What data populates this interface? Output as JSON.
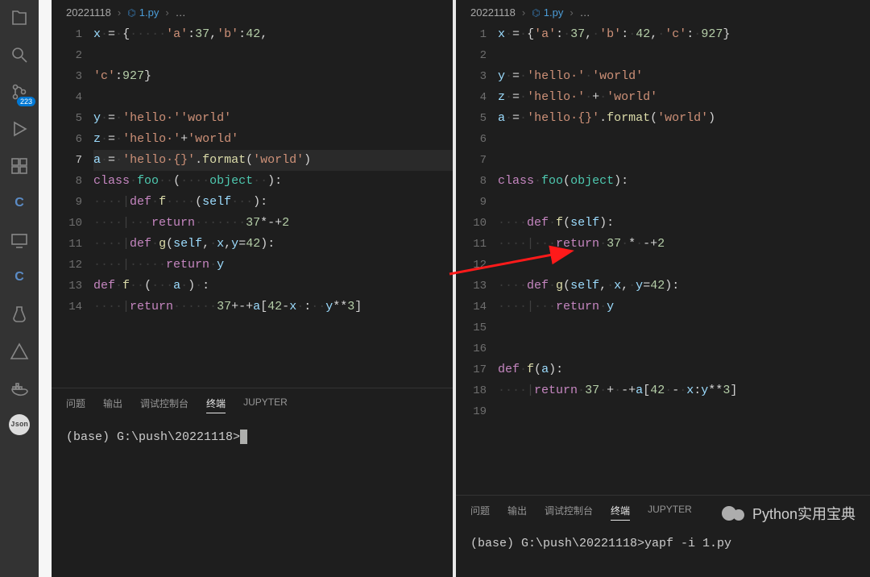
{
  "activity": {
    "scm_badge": "223",
    "json_label": "Json"
  },
  "breadcrumbs": {
    "folder": "20221118",
    "file": "1.py",
    "tail": "…"
  },
  "left_editor": {
    "line_count": 14,
    "active_line": 7,
    "lines": {
      "1": [
        [
          "id",
          "x"
        ],
        [
          "ws",
          "·"
        ],
        [
          "op",
          "="
        ],
        [
          "ws",
          "·"
        ],
        [
          "op",
          "{"
        ],
        [
          "ws",
          "·····"
        ],
        [
          "str",
          "'a'"
        ],
        [
          "op",
          ":"
        ],
        [
          "num",
          "37"
        ],
        [
          "op",
          ","
        ],
        [
          "str",
          "'b'"
        ],
        [
          "op",
          ":"
        ],
        [
          "num",
          "42"
        ],
        [
          "op",
          ","
        ]
      ],
      "2": [],
      "3": [
        [
          "str",
          "'c'"
        ],
        [
          "op",
          ":"
        ],
        [
          "num",
          "927"
        ],
        [
          "op",
          "}"
        ]
      ],
      "4": [],
      "5": [
        [
          "id",
          "y"
        ],
        [
          "ws",
          "·"
        ],
        [
          "op",
          "="
        ],
        [
          "ws",
          "·"
        ],
        [
          "str",
          "'hello·'"
        ],
        [
          "str",
          "'world'"
        ]
      ],
      "6": [
        [
          "id",
          "z"
        ],
        [
          "ws",
          "·"
        ],
        [
          "op",
          "="
        ],
        [
          "ws",
          "·"
        ],
        [
          "str",
          "'hello·'"
        ],
        [
          "op",
          "+"
        ],
        [
          "str",
          "'world'"
        ]
      ],
      "7": [
        [
          "id",
          "a"
        ],
        [
          "ws",
          "·"
        ],
        [
          "op",
          "="
        ],
        [
          "ws",
          "·"
        ],
        [
          "str",
          "'hello·{}'"
        ],
        [
          "op",
          "."
        ],
        [
          "fn",
          "format"
        ],
        [
          "op",
          "("
        ],
        [
          "str",
          "'world'"
        ],
        [
          "op",
          ")"
        ]
      ],
      "8": [
        [
          "kw",
          "class"
        ],
        [
          "ws",
          "·"
        ],
        [
          "cls",
          "foo"
        ],
        [
          "ws",
          "··"
        ],
        [
          "op",
          "("
        ],
        [
          "ws",
          "····"
        ],
        [
          "cls",
          "object"
        ],
        [
          "ws",
          "··"
        ],
        [
          "op",
          ")"
        ],
        [
          "op",
          ":"
        ]
      ],
      "9": [
        [
          "ws",
          "····"
        ],
        [
          "gd",
          "|"
        ],
        [
          "kw",
          "def"
        ],
        [
          "ws",
          "·"
        ],
        [
          "fn",
          "f"
        ],
        [
          "ws",
          "····"
        ],
        [
          "op",
          "("
        ],
        [
          "id",
          "self"
        ],
        [
          "ws",
          "···"
        ],
        [
          "op",
          ")"
        ],
        [
          "op",
          ":"
        ]
      ],
      "10": [
        [
          "ws",
          "····"
        ],
        [
          "gd",
          "|"
        ],
        [
          "ws",
          "···"
        ],
        [
          "kw",
          "return"
        ],
        [
          "ws",
          "·······"
        ],
        [
          "num",
          "37"
        ],
        [
          "op",
          "*"
        ],
        [
          "op",
          "-"
        ],
        [
          "op",
          "+"
        ],
        [
          "num",
          "2"
        ]
      ],
      "11": [
        [
          "ws",
          "····"
        ],
        [
          "gd",
          "|"
        ],
        [
          "kw",
          "def"
        ],
        [
          "ws",
          "·"
        ],
        [
          "fn",
          "g"
        ],
        [
          "op",
          "("
        ],
        [
          "id",
          "self"
        ],
        [
          "op",
          ","
        ],
        [
          "ws",
          "·"
        ],
        [
          "id",
          "x"
        ],
        [
          "op",
          ","
        ],
        [
          "id",
          "y"
        ],
        [
          "op",
          "="
        ],
        [
          "num",
          "42"
        ],
        [
          "op",
          ")"
        ],
        [
          "op",
          ":"
        ]
      ],
      "12": [
        [
          "ws",
          "····"
        ],
        [
          "gd",
          "|"
        ],
        [
          "ws",
          "·····"
        ],
        [
          "kw",
          "return"
        ],
        [
          "ws",
          "·"
        ],
        [
          "id",
          "y"
        ]
      ],
      "13": [
        [
          "kw",
          "def"
        ],
        [
          "ws",
          "·"
        ],
        [
          "fn",
          "f"
        ],
        [
          "ws",
          "··"
        ],
        [
          "op",
          "("
        ],
        [
          "ws",
          "···"
        ],
        [
          "id",
          "a"
        ],
        [
          "ws",
          "·"
        ],
        [
          "op",
          ")"
        ],
        [
          "ws",
          "·"
        ],
        [
          "op",
          ":"
        ]
      ],
      "14": [
        [
          "ws",
          "····"
        ],
        [
          "gd",
          "|"
        ],
        [
          "kw",
          "return"
        ],
        [
          "ws",
          "······"
        ],
        [
          "num",
          "37"
        ],
        [
          "op",
          "+"
        ],
        [
          "op",
          "-"
        ],
        [
          "op",
          "+"
        ],
        [
          "id",
          "a"
        ],
        [
          "op",
          "["
        ],
        [
          "num",
          "42"
        ],
        [
          "op",
          "-"
        ],
        [
          "id",
          "x"
        ],
        [
          "ws",
          "·"
        ],
        [
          "op",
          ":"
        ],
        [
          "ws",
          "··"
        ],
        [
          "id",
          "y"
        ],
        [
          "op",
          "**"
        ],
        [
          "num",
          "3"
        ],
        [
          "op",
          "]"
        ]
      ]
    }
  },
  "right_editor": {
    "line_count": 19,
    "active_line": 0,
    "lines": {
      "1": [
        [
          "id",
          "x"
        ],
        [
          "ws",
          "·"
        ],
        [
          "op",
          "="
        ],
        [
          "ws",
          "·"
        ],
        [
          "op",
          "{"
        ],
        [
          "str",
          "'a'"
        ],
        [
          "op",
          ":"
        ],
        [
          "ws",
          "·"
        ],
        [
          "num",
          "37"
        ],
        [
          "op",
          ","
        ],
        [
          "ws",
          "·"
        ],
        [
          "str",
          "'b'"
        ],
        [
          "op",
          ":"
        ],
        [
          "ws",
          "·"
        ],
        [
          "num",
          "42"
        ],
        [
          "op",
          ","
        ],
        [
          "ws",
          "·"
        ],
        [
          "str",
          "'c'"
        ],
        [
          "op",
          ":"
        ],
        [
          "ws",
          "·"
        ],
        [
          "num",
          "927"
        ],
        [
          "op",
          "}"
        ]
      ],
      "2": [],
      "3": [
        [
          "id",
          "y"
        ],
        [
          "ws",
          "·"
        ],
        [
          "op",
          "="
        ],
        [
          "ws",
          "·"
        ],
        [
          "str",
          "'hello·'"
        ],
        [
          "ws",
          "·"
        ],
        [
          "str",
          "'world'"
        ]
      ],
      "4": [
        [
          "id",
          "z"
        ],
        [
          "ws",
          "·"
        ],
        [
          "op",
          "="
        ],
        [
          "ws",
          "·"
        ],
        [
          "str",
          "'hello·'"
        ],
        [
          "ws",
          "·"
        ],
        [
          "op",
          "+"
        ],
        [
          "ws",
          "·"
        ],
        [
          "str",
          "'world'"
        ]
      ],
      "5": [
        [
          "id",
          "a"
        ],
        [
          "ws",
          "·"
        ],
        [
          "op",
          "="
        ],
        [
          "ws",
          "·"
        ],
        [
          "str",
          "'hello·{}'"
        ],
        [
          "op",
          "."
        ],
        [
          "fn",
          "format"
        ],
        [
          "op",
          "("
        ],
        [
          "str",
          "'world'"
        ],
        [
          "op",
          ")"
        ]
      ],
      "6": [],
      "7": [],
      "8": [
        [
          "kw",
          "class"
        ],
        [
          "ws",
          "·"
        ],
        [
          "cls",
          "foo"
        ],
        [
          "op",
          "("
        ],
        [
          "cls",
          "object"
        ],
        [
          "op",
          ")"
        ],
        [
          "op",
          ":"
        ]
      ],
      "9": [],
      "10": [
        [
          "ws",
          "····"
        ],
        [
          "kw",
          "def"
        ],
        [
          "ws",
          "·"
        ],
        [
          "fn",
          "f"
        ],
        [
          "op",
          "("
        ],
        [
          "id",
          "self"
        ],
        [
          "op",
          ")"
        ],
        [
          "op",
          ":"
        ]
      ],
      "11": [
        [
          "ws",
          "····"
        ],
        [
          "gd",
          "|"
        ],
        [
          "ws",
          "···"
        ],
        [
          "kw",
          "return"
        ],
        [
          "ws",
          "·"
        ],
        [
          "num",
          "37"
        ],
        [
          "ws",
          "·"
        ],
        [
          "op",
          "*"
        ],
        [
          "ws",
          "·"
        ],
        [
          "op",
          "-"
        ],
        [
          "op",
          "+"
        ],
        [
          "num",
          "2"
        ]
      ],
      "12": [],
      "13": [
        [
          "ws",
          "····"
        ],
        [
          "kw",
          "def"
        ],
        [
          "ws",
          "·"
        ],
        [
          "fn",
          "g"
        ],
        [
          "op",
          "("
        ],
        [
          "id",
          "self"
        ],
        [
          "op",
          ","
        ],
        [
          "ws",
          "·"
        ],
        [
          "id",
          "x"
        ],
        [
          "op",
          ","
        ],
        [
          "ws",
          "·"
        ],
        [
          "id",
          "y"
        ],
        [
          "op",
          "="
        ],
        [
          "num",
          "42"
        ],
        [
          "op",
          ")"
        ],
        [
          "op",
          ":"
        ]
      ],
      "14": [
        [
          "ws",
          "····"
        ],
        [
          "gd",
          "|"
        ],
        [
          "ws",
          "···"
        ],
        [
          "kw",
          "return"
        ],
        [
          "ws",
          "·"
        ],
        [
          "id",
          "y"
        ]
      ],
      "15": [],
      "16": [],
      "17": [
        [
          "kw",
          "def"
        ],
        [
          "ws",
          "·"
        ],
        [
          "fn",
          "f"
        ],
        [
          "op",
          "("
        ],
        [
          "id",
          "a"
        ],
        [
          "op",
          ")"
        ],
        [
          "op",
          ":"
        ]
      ],
      "18": [
        [
          "ws",
          "····"
        ],
        [
          "gd",
          "|"
        ],
        [
          "kw",
          "return"
        ],
        [
          "ws",
          "·"
        ],
        [
          "num",
          "37"
        ],
        [
          "ws",
          "·"
        ],
        [
          "op",
          "+"
        ],
        [
          "ws",
          "·"
        ],
        [
          "op",
          "-"
        ],
        [
          "op",
          "+"
        ],
        [
          "id",
          "a"
        ],
        [
          "op",
          "["
        ],
        [
          "num",
          "42"
        ],
        [
          "ws",
          "·"
        ],
        [
          "op",
          "-"
        ],
        [
          "ws",
          "·"
        ],
        [
          "id",
          "x"
        ],
        [
          "op",
          ":"
        ],
        [
          "id",
          "y"
        ],
        [
          "op",
          "**"
        ],
        [
          "num",
          "3"
        ],
        [
          "op",
          "]"
        ]
      ],
      "19": []
    }
  },
  "panel": {
    "tabs": {
      "problems": "问题",
      "output": "输出",
      "debug": "调试控制台",
      "terminal": "终端",
      "jupyter": "JUPYTER"
    },
    "prompt_left": "(base) G:\\push\\20221118>",
    "prompt_right": "(base) G:\\push\\20221118>yapf -i 1.py"
  },
  "watermark": "Python实用宝典"
}
